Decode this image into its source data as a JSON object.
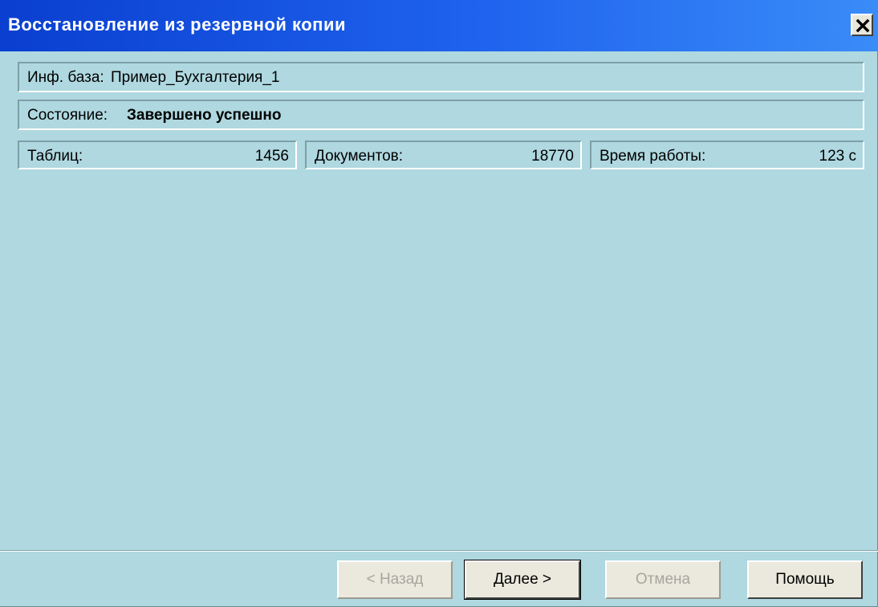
{
  "window": {
    "title": "Восстановление из резервной копии"
  },
  "info": {
    "db_label": "Инф. база:",
    "db_value": "Пример_Бухгалтерия_1",
    "state_label": "Состояние:",
    "state_value": "Завершено успешно"
  },
  "stats": {
    "tables_label": "Таблиц:",
    "tables_value": "1456",
    "documents_label": "Документов:",
    "documents_value": "18770",
    "time_label": "Время работы:",
    "time_value": "123 с"
  },
  "buttons": {
    "back_label": "< Назад",
    "next_label": "Далее >",
    "cancel_label": "Отмена",
    "help_label": "Помощь"
  },
  "colors": {
    "background": "#afd8e0",
    "titlebar": "#0a3fd0"
  },
  "icons": {
    "close": "close-icon"
  }
}
